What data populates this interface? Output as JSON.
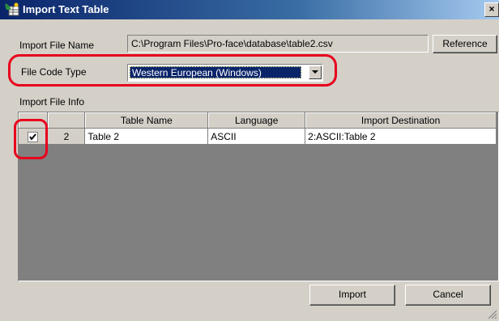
{
  "window": {
    "title": "Import Text Table",
    "close_glyph": "×"
  },
  "import_file": {
    "label": "Import File Name",
    "path": "C:\\Program Files\\Pro-face\\database\\table2.csv",
    "reference_button": "Reference"
  },
  "file_code": {
    "label": "File Code Type",
    "selected": "Western European (Windows)"
  },
  "file_info": {
    "label": "Import File Info",
    "columns": [
      "",
      "",
      "Table Name",
      "Language",
      "Import Destination"
    ],
    "rows": [
      {
        "checked": true,
        "number": "2",
        "table_name": "Table 2",
        "language": "ASCII",
        "destination": "2:ASCII:Table 2"
      }
    ]
  },
  "buttons": {
    "import": "Import",
    "cancel": "Cancel"
  },
  "colors": {
    "highlight": "#e8001c",
    "titlebar": "#0a246a",
    "selection": "#0a246a"
  },
  "icons": {
    "title": "import-table-icon",
    "dropdown": "chevron-down-icon",
    "check": "checkmark-icon"
  }
}
